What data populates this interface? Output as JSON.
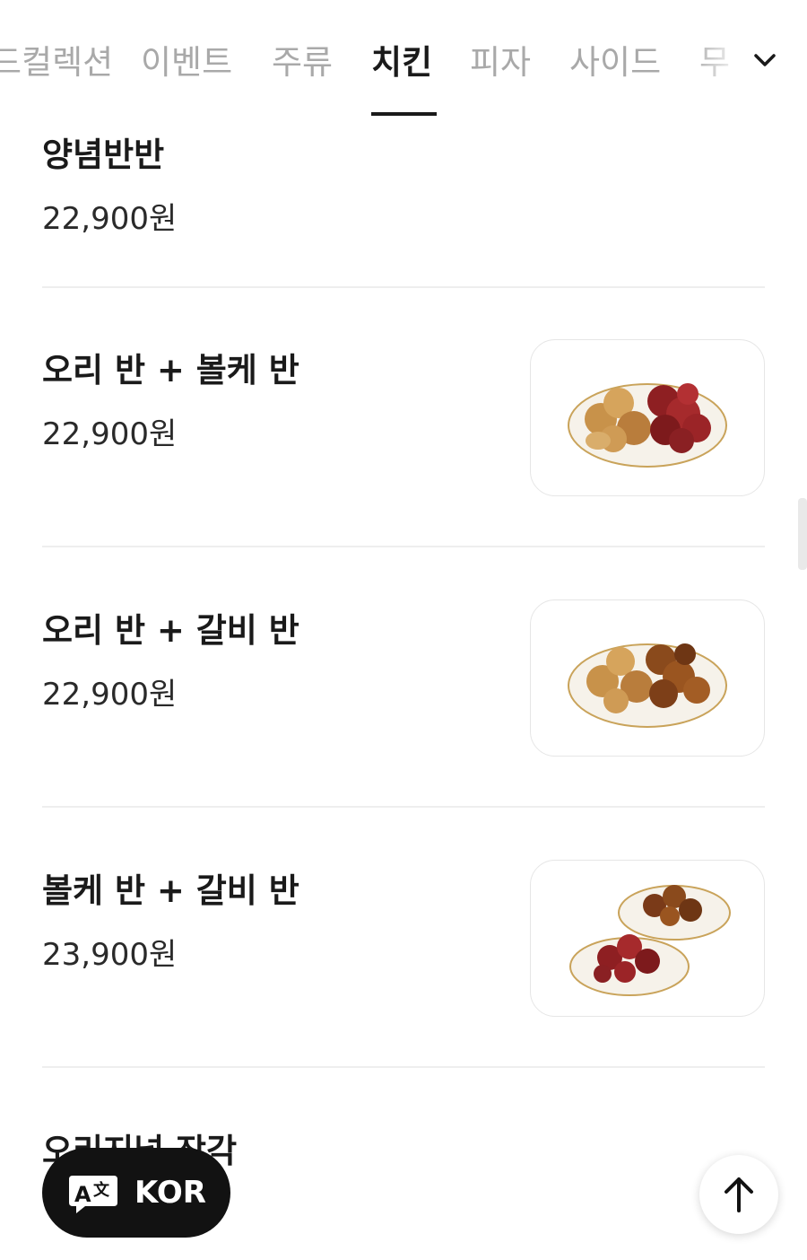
{
  "tabs": {
    "items": [
      {
        "label": "드컬렉션"
      },
      {
        "label": "이벤트"
      },
      {
        "label": "주류"
      },
      {
        "label": "치킨",
        "active": true
      },
      {
        "label": "피자"
      },
      {
        "label": "사이드"
      },
      {
        "label": "무"
      }
    ],
    "expand_icon": "chevron-down-icon"
  },
  "menu": {
    "items": [
      {
        "name": "양념반반",
        "price": "22,900원"
      },
      {
        "name": "오리 반 + 볼케 반",
        "price": "22,900원",
        "image": "chicken-plate-image"
      },
      {
        "name": "오리 반 + 갈비 반",
        "price": "22,900원",
        "image": "chicken-plate-image"
      },
      {
        "name": "볼케 반 + 갈비 반",
        "price": "23,900원",
        "image": "chicken-two-plates-image"
      },
      {
        "name": "오리지널 장각",
        "price": ""
      }
    ]
  },
  "language_button": {
    "label": "KOR",
    "icon": "translate-icon"
  },
  "scroll_top_button": {
    "icon": "arrow-up-icon"
  },
  "colors": {
    "text": "#1a1a1a",
    "inactive_tab": "#a9a9a9",
    "lang_button_bg": "#121212",
    "divider": "#eeeeee"
  }
}
